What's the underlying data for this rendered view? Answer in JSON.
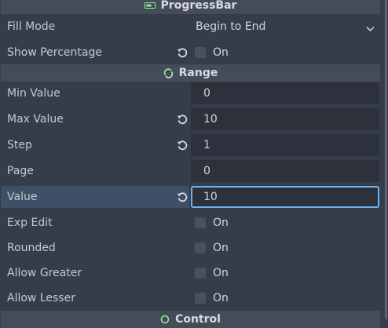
{
  "sections": {
    "progressbar": {
      "title": "ProgressBar",
      "icon": "progressbar-icon"
    },
    "range": {
      "title": "Range",
      "icon": "range-icon"
    },
    "control": {
      "title": "Control",
      "icon": "control-icon"
    }
  },
  "props": {
    "fill_mode": {
      "label": "Fill Mode",
      "value": "Begin to End"
    },
    "show_percentage": {
      "label": "Show Percentage",
      "checked": false,
      "text": "On"
    },
    "min_value": {
      "label": "Min Value",
      "value": "0"
    },
    "max_value": {
      "label": "Max Value",
      "value": "10"
    },
    "step": {
      "label": "Step",
      "value": "1"
    },
    "page": {
      "label": "Page",
      "value": "0"
    },
    "value": {
      "label": "Value",
      "value": "10"
    },
    "exp_edit": {
      "label": "Exp Edit",
      "checked": false,
      "text": "On"
    },
    "rounded": {
      "label": "Rounded",
      "checked": false,
      "text": "On"
    },
    "allow_greater": {
      "label": "Allow Greater",
      "checked": false,
      "text": "On"
    },
    "allow_lesser": {
      "label": "Allow Lesser",
      "checked": false,
      "text": "On"
    }
  },
  "colors": {
    "accent": "#6fb2f2",
    "section_bg": "#454c59",
    "panel_bg": "#363d4a",
    "icon_green": "#8eef97"
  }
}
